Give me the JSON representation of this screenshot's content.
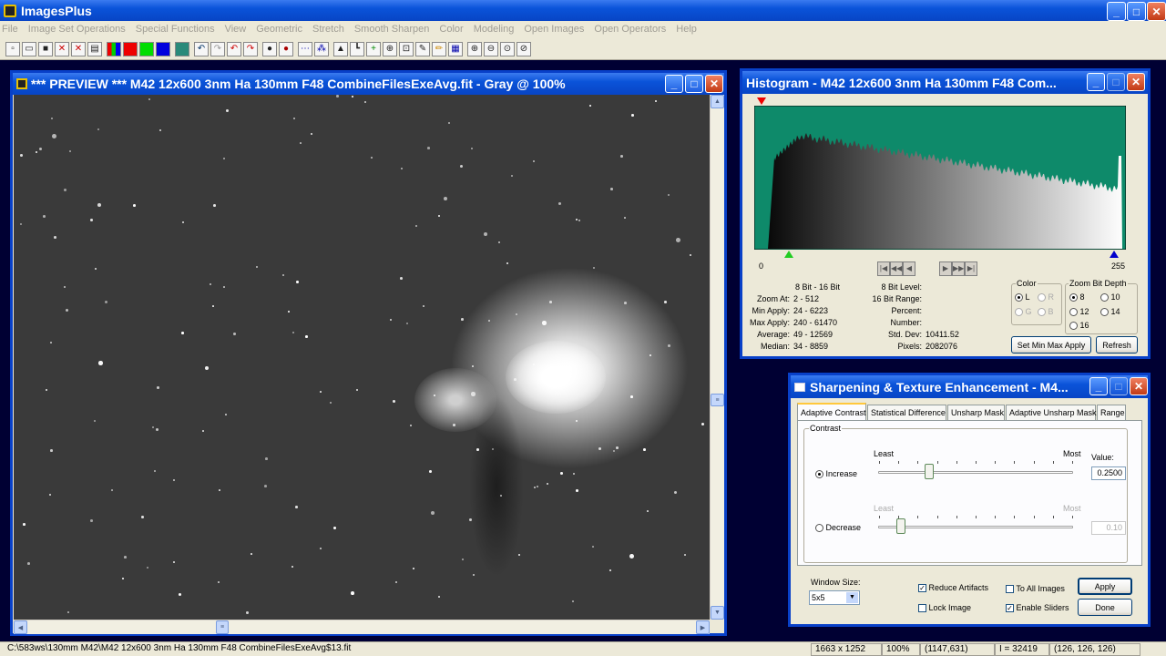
{
  "app": {
    "title": "ImagesPlus"
  },
  "menu": [
    "File",
    "Image Set Operations",
    "Special Functions",
    "View",
    "Geometric",
    "Stretch",
    "Smooth Sharpen",
    "Color",
    "Modeling",
    "Open Images",
    "Open Operators",
    "Help"
  ],
  "preview": {
    "title": "*** PREVIEW *** M42 12x600 3nm Ha 130mm F48 CombineFilesExeAvg.fit - Gray @ 100%"
  },
  "histogram": {
    "title": "Histogram - M42 12x600 3nm Ha 130mm F48 Com...",
    "axis_min": "0",
    "axis_max": "255",
    "colors": {
      "background": "#0E8A6A",
      "marker_min": "#22CC22",
      "marker_max": "#0000CC",
      "marker_top": "#EE0000"
    },
    "stats_header": "8 Bit - 16 Bit",
    "stats_left": [
      {
        "label": "Zoom At:",
        "value": "2 - 512"
      },
      {
        "label": "Min Apply:",
        "value": "24 - 6223"
      },
      {
        "label": "Max Apply:",
        "value": "240 - 61470"
      },
      {
        "label": "Average:",
        "value": "49 - 12569"
      },
      {
        "label": "Median:",
        "value": "34 - 8859"
      }
    ],
    "stats_right": [
      {
        "label": "8 Bit Level:",
        "value": ""
      },
      {
        "label": "16 Bit Range:",
        "value": ""
      },
      {
        "label": "Percent:",
        "value": ""
      },
      {
        "label": "Number:",
        "value": ""
      },
      {
        "label": "Std. Dev:",
        "value": "10411.52"
      },
      {
        "label": "Pixels:",
        "value": "2082076"
      }
    ],
    "color_group": {
      "title": "Color",
      "options": [
        "L",
        "R",
        "G",
        "B"
      ],
      "selected": "L"
    },
    "zoom_group": {
      "title": "Zoom Bit Depth",
      "options": [
        "8",
        "10",
        "12",
        "14",
        "16"
      ],
      "selected": "8"
    },
    "set_minmax_label": "Set Min Max Apply",
    "refresh_label": "Refresh"
  },
  "sharpen": {
    "title": "Sharpening & Texture Enhancement - M4...",
    "tabs": [
      "Adaptive Contrast",
      "Statistical Difference",
      "Unsharp Mask",
      "Adaptive Unsharp Mask",
      "Range"
    ],
    "active_tab": "Adaptive Contrast",
    "contrast_label": "Contrast",
    "least_label": "Least",
    "most_label": "Most",
    "value_label": "Value:",
    "increase_label": "Increase",
    "increase_value": "0.2500",
    "increase_level": 0.25,
    "decrease_label": "Decrease",
    "decrease_value": "0.10",
    "decrease_level": 0.1,
    "selected_mode": "Increase",
    "window_size_label": "Window Size:",
    "window_size_value": "5x5",
    "reduce_artifacts_label": "Reduce Artifacts",
    "reduce_artifacts": true,
    "to_all_images_label": "To All Images",
    "to_all_images": false,
    "lock_image_label": "Lock Image",
    "lock_image": false,
    "enable_sliders_label": "Enable Sliders",
    "enable_sliders": true,
    "apply_label": "Apply",
    "done_label": "Done"
  },
  "status": {
    "path": "C:\\583ws\\130mm M42\\M42 12x600 3nm Ha 130mm F48 CombineFilesExeAvg$13.fit",
    "dimensions": "1663 x 1252",
    "zoom": "100%",
    "coords": "(1147,631)",
    "intensity": "I = 32419",
    "rgb": "(126, 126, 126)"
  }
}
